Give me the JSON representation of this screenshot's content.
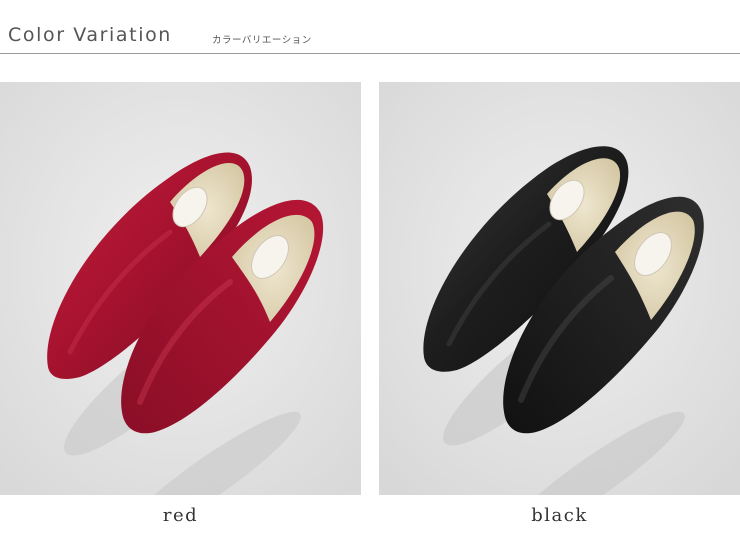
{
  "header": {
    "title": "Color Variation",
    "subtitle": "カラーバリエーション"
  },
  "variations": [
    {
      "label": "red",
      "color": "#a8132f"
    },
    {
      "label": "black",
      "color": "#1b1b1b"
    }
  ]
}
